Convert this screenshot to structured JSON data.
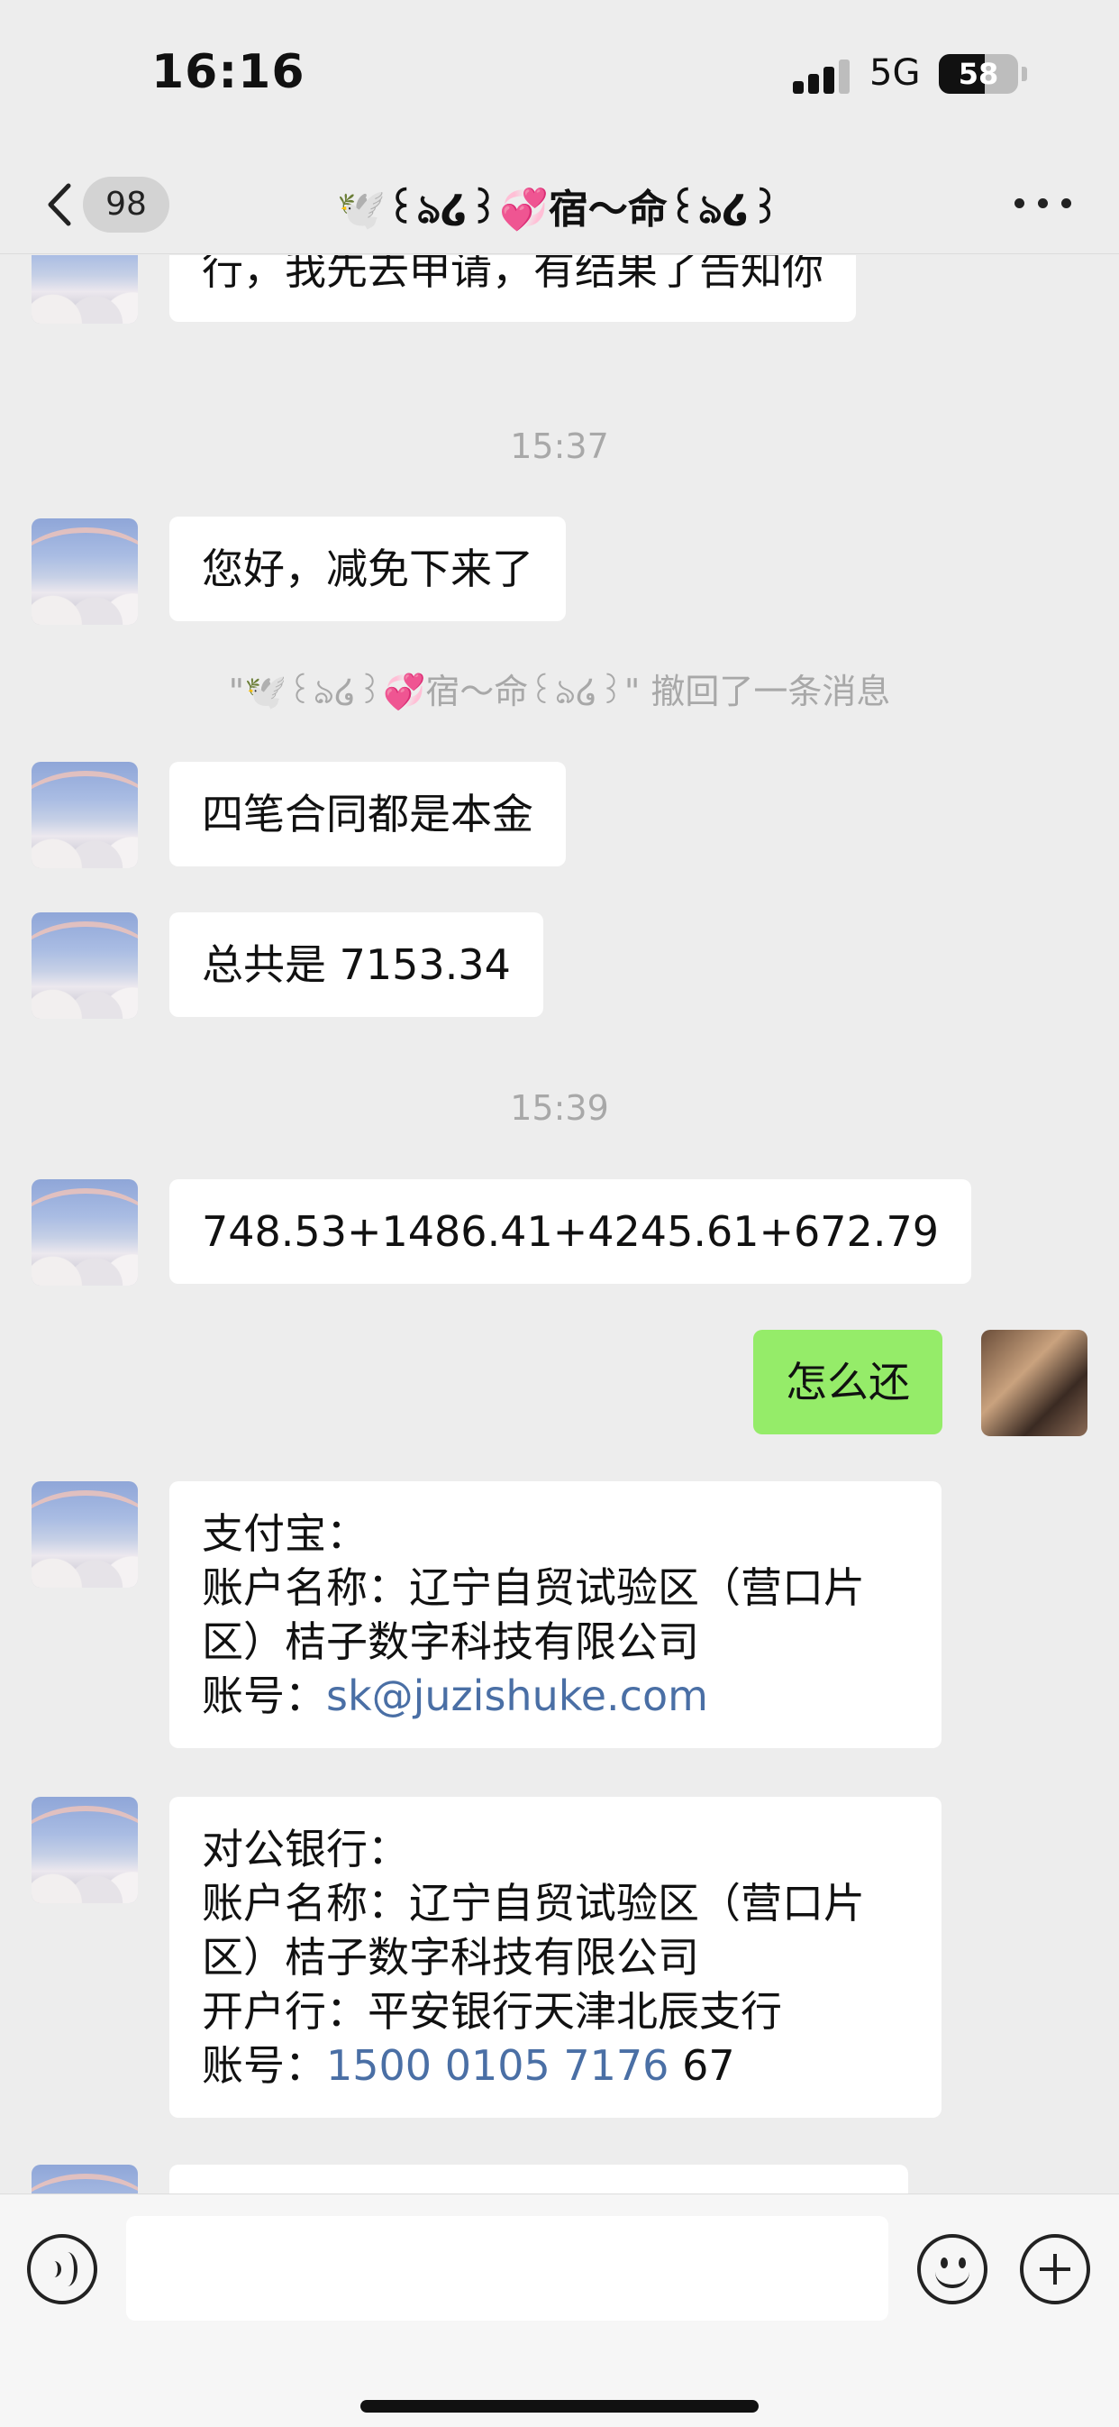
{
  "status_bar": {
    "time": "16:16",
    "network": "5G",
    "battery": "58",
    "battery_level": 0.58
  },
  "nav": {
    "unread_count": "98",
    "title": "🕊️꒰ঌ໒꒱💞宿～命꒰ঌ໒꒱"
  },
  "messages": {
    "m1": {
      "lines": [
        "行，我先去申请，有结果了告知你"
      ]
    },
    "time1": "15:37",
    "m2": {
      "lines": [
        "您好，减免下来了"
      ]
    },
    "recall_note": "\"🕊️꒰ঌ໒꒱💞宿～命꒰ঌ໒꒱\" 撤回了一条消息",
    "m3": {
      "lines": [
        "四笔合同都是本金"
      ]
    },
    "m4": {
      "lines": [
        "总共是 7153.34"
      ]
    },
    "time2": "15:39",
    "m5": {
      "lines": [
        "748.53+1486.41+4245.61+672.79"
      ]
    },
    "m6_self": {
      "lines": [
        "怎么还"
      ]
    },
    "m7": {
      "line1": "支付宝：",
      "line2": "账户名称：辽宁自贸试验区（营口片",
      "line3": "区）桔子数字科技有限公司",
      "line4_prefix": "账号：",
      "line4_link": "sk@juzishuke.com"
    },
    "m8": {
      "line1": "对公银行：",
      "line2": "账户名称：辽宁自贸试验区（营口片",
      "line3": "区）桔子数字科技有限公司",
      "line4": "开户行：平安银行天津北辰支行",
      "line5_prefix": "账号：",
      "line5_link": "1500 0105 7176",
      "line5_suffix": " 67"
    }
  },
  "input": {
    "placeholder": ""
  },
  "colors": {
    "background": "#ededed",
    "bubble_other": "#ffffff",
    "bubble_self": "#95ec69",
    "link": "#4a6fa5",
    "timestamp": "#a8a8a8"
  },
  "icons": {
    "back": "chevron-left-icon",
    "more": "more-dots-icon",
    "voice": "voice-icon",
    "emoji": "emoji-icon",
    "plus": "plus-icon"
  }
}
